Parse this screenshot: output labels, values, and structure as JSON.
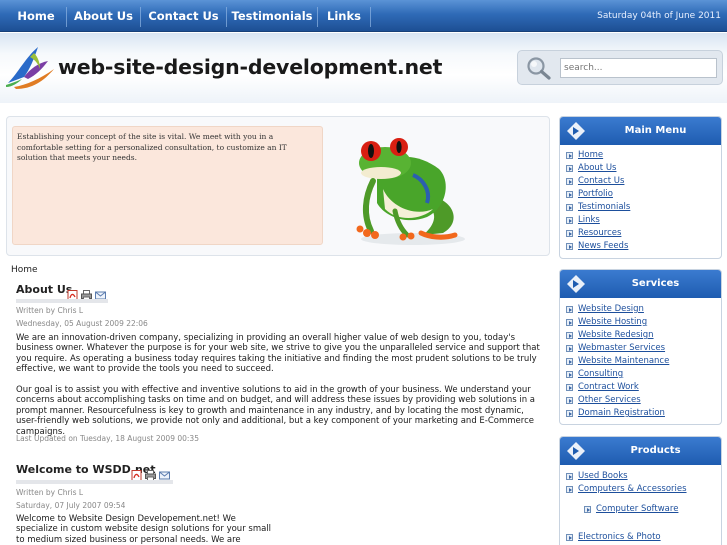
{
  "nav": {
    "items": [
      "Home",
      "About Us",
      "Contact Us",
      "Testimonials",
      "Links"
    ],
    "date": "Saturday 04th of June 2011"
  },
  "header": {
    "site_title": "web-site-design-development.net",
    "search_placeholder": "search..."
  },
  "intro": {
    "text": "Establishing your concept of the site is vital. We meet with you in a comfortable setting for a personalized consultation, to customize an IT solution that meets your needs."
  },
  "breadcrumb": "Home",
  "articles": [
    {
      "title": "About Us",
      "author": "Written by Chris L",
      "date": "Wednesday, 05 August 2009 22:06",
      "paragraphs": [
        "We are an innovation-driven company, specializing in providing an overall higher value of web design to you, today's business owner. Whatever the purpose is for your web site, we strive to  give you the unparalleled service and support that you require. As operating a business today requires taking the initiative and finding the most prudent solutions to be truly effective, we want to provide the tools you need to succeed.",
        "Our goal is to assist you with effective and inventive solutions to aid in the growth of your business. We understand your concerns about accomplishing tasks on time and on budget, and will address these issues by providing web solutions in a prompt manner. Resourcefulness is key to growth and maintenance in any industry, and by locating the most dynamic, user-friendly web solutions, we provide not only and additional, but a key component of your marketing and E-Commerce campaigns."
      ],
      "updated": "Last Updated on Tuesday, 18 August 2009 00:35"
    },
    {
      "title": "Welcome to WSDD.net",
      "author": "Written by Chris L",
      "date": "Saturday, 07 July 2007 09:54",
      "paragraphs": [
        "Welcome to Website Design Developement.net! We specialize in custom website design solutions for your small to medium sized business or personal needs. We are located in sunny"
      ]
    }
  ],
  "sidebar": {
    "main_menu": {
      "title": "Main Menu",
      "items": [
        "Home",
        "About Us",
        "Contact Us",
        "Portfolio",
        "Testimonials",
        "Links",
        "Resources",
        "News Feeds"
      ]
    },
    "services": {
      "title": "Services",
      "items": [
        "Website Design",
        "Website Hosting",
        "Website Redesign",
        "Webmaster Services",
        "Website Maintenance",
        "Consulting",
        "Contract Work",
        "Other Services",
        "Domain Registration"
      ]
    },
    "products": {
      "title": "Products",
      "items": [
        "Used Books",
        "Computers & Accessories",
        "Computer Software",
        "Electronics & Photo"
      ]
    }
  },
  "colors": {
    "nav_blue": "#2f6bb7",
    "link_blue": "#1d4f9c",
    "intro_bg": "#fbe7dc"
  },
  "icons": {
    "pdf": "pdf-icon",
    "print": "print-icon",
    "email": "email-icon",
    "search": "search-icon",
    "module": "arrow-badge-icon"
  }
}
